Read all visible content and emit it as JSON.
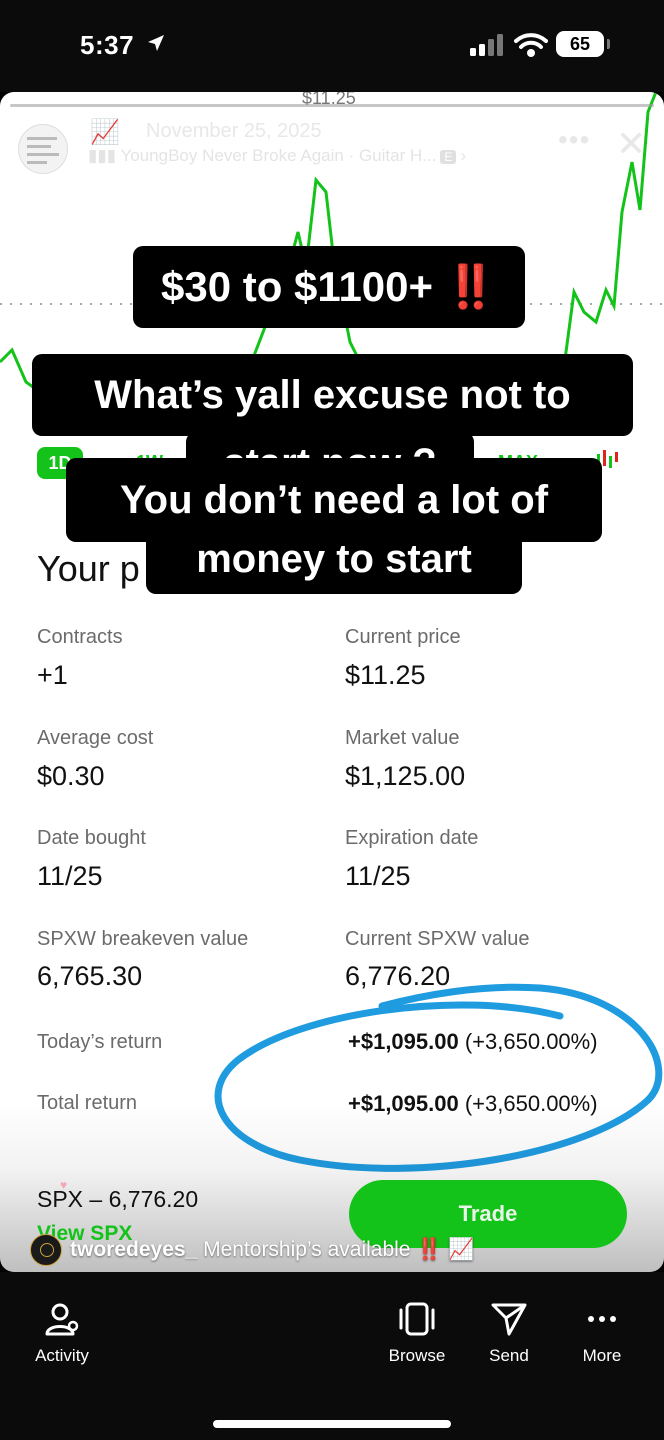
{
  "status_bar": {
    "time": "5:37",
    "battery": "65"
  },
  "story": {
    "top_price": "$11.25",
    "chart_emoji": "📈",
    "date": "November 25, 2025",
    "music": "YoungBoy Never Broke Again · Guitar H...",
    "explicit": "E",
    "more": "•••",
    "close": "✕"
  },
  "captions": {
    "line1": "$30 to $1100+",
    "line1_emoji": "‼️",
    "line2a": "What’s yall excuse not to",
    "line2b": "start now ?",
    "line3a": "You don’t need a lot of",
    "line3b": "money to start"
  },
  "ranges": {
    "selected": "1D",
    "w": "1W",
    "max": "MAX"
  },
  "position": {
    "heading": "Your p",
    "fields": [
      {
        "label": "Contracts",
        "value": "+1"
      },
      {
        "label": "Current price",
        "value": "$11.25"
      },
      {
        "label": "Average cost",
        "value": "$0.30"
      },
      {
        "label": "Market value",
        "value": "$1,125.00"
      },
      {
        "label": "Date bought",
        "value": "11/25"
      },
      {
        "label": "Expiration date",
        "value": "11/25"
      },
      {
        "label": "SPXW breakeven value",
        "value": "6,765.30"
      },
      {
        "label": "Current SPXW value",
        "value": "6,776.20"
      }
    ],
    "todays_return": {
      "label": "Today’s return",
      "amount": "+$1,095.00",
      "percent": "(+3,650.00%)"
    },
    "total_return": {
      "label": "Total return",
      "amount": "+$1,095.00",
      "percent": "(+3,650.00%)"
    }
  },
  "footer": {
    "spx": "SPX – 6,776.20",
    "view": "View SPX",
    "trade": "Trade"
  },
  "author": {
    "username": "tworedeyes_",
    "text": "Mentorship’s available",
    "emoji": "‼️ 📈"
  },
  "nav": {
    "activity": "Activity",
    "browse": "Browse",
    "send": "Send",
    "more": "More"
  },
  "colors": {
    "accent_green": "#13c319",
    "circle_blue": "#1f9be0",
    "red": "#e0241b"
  }
}
